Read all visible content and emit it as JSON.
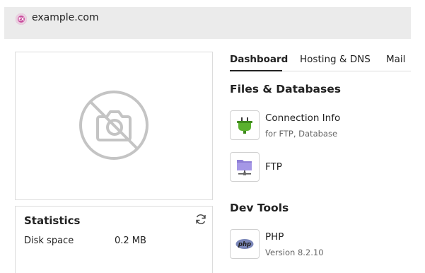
{
  "header": {
    "site_badge": "EX",
    "site_name": "example.com"
  },
  "statistics": {
    "title": "Statistics",
    "disk_label": "Disk space",
    "disk_value": "0.2 MB"
  },
  "tabs": [
    {
      "label": "Dashboard",
      "active": true
    },
    {
      "label": "Hosting & DNS",
      "active": false
    },
    {
      "label": "Mail",
      "active": false
    }
  ],
  "sections": {
    "files_title": "Files & Databases",
    "dev_title": "Dev Tools"
  },
  "tools": {
    "connection": {
      "name": "Connection Info",
      "sub": "for FTP, Database"
    },
    "ftp": {
      "name": "FTP"
    },
    "php": {
      "name": "PHP",
      "sub": "Version 8.2.10",
      "icon_text": "php"
    }
  },
  "icons": {
    "site": "site-badge-icon",
    "no_photo": "camera-off-icon",
    "refresh": "refresh-icon",
    "connection": "plug-icon",
    "ftp": "folder-network-icon",
    "php": "php-icon"
  },
  "colors": {
    "topbar": "#ebebeb",
    "badge": "#c94f9e",
    "plug": "#5ab02e",
    "folder": "#8f7fd6",
    "php": "#7a86b8"
  }
}
